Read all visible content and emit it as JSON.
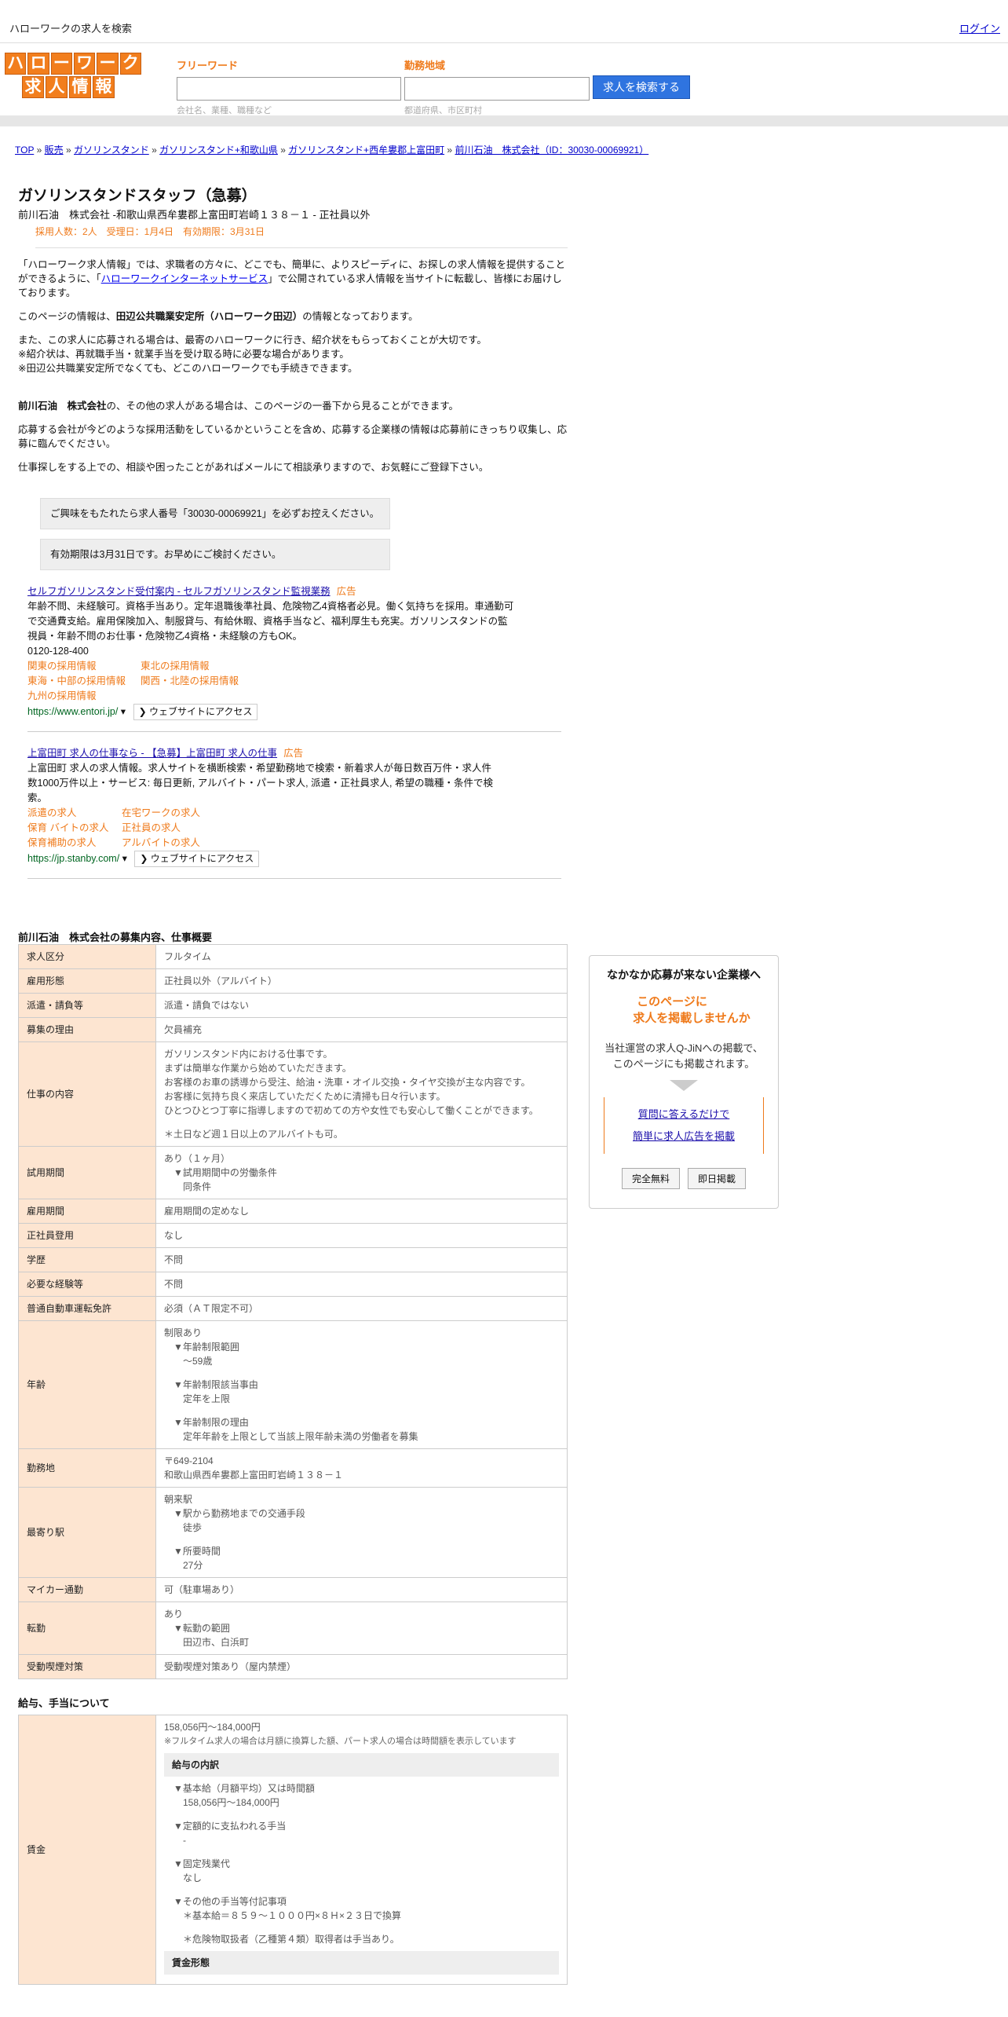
{
  "topbar": {
    "site_name": "ハローワークの求人を検索",
    "login": "ログイン"
  },
  "logo": {
    "row1": [
      "ハ",
      "ロ",
      "ー",
      "ワ",
      "ー",
      "ク"
    ],
    "row2": [
      "求",
      "人",
      "情",
      "報"
    ]
  },
  "search": {
    "freeword_label": "フリーワード",
    "freeword_hint": "会社名、業種、職種など",
    "area_label": "勤務地域",
    "area_hint": "都道府県、市区町村",
    "button": "求人を検索する"
  },
  "breadcrumb": {
    "items": [
      "TOP",
      "販売",
      "ガソリンスタンド",
      "ガソリンスタンド+和歌山県",
      "ガソリンスタンド+西牟婁郡上富田町",
      "前川石油　株式会社（ID：30030-00069921）"
    ],
    "sep": "»"
  },
  "job": {
    "title": "ガソリンスタンドスタッフ（急募）",
    "subtitle": "前川石油　株式会社 -和歌山県西牟婁郡上富田町岩崎１３８－１ - 正社員以外",
    "meta": "採用人数：2人　受理日：1月4日　有効期限：3月31日"
  },
  "intro": {
    "p1_a": "「ハローワーク求人情報」では、求職者の方々に、どこでも、簡単に、よりスピーディに、お探しの求人情報を提供することができるように、「",
    "p1_link": "ハローワークインターネットサービス",
    "p1_b": "」で公開されている求人情報を当サイトに転載し、皆様にお届けしております。",
    "p2_a": "このページの情報は、",
    "p2_bold": "田辺公共職業安定所（ハローワーク田辺）",
    "p2_b": "の情報となっております。",
    "p3": "また、この求人に応募される場合は、最寄のハローワークに行き、紹介状をもらっておくことが大切です。",
    "p3_2": "※紹介状は、再就職手当・就業手当を受け取る時に必要な場合があります。",
    "p3_3": "※田辺公共職業安定所でなくても、どこのハローワークでも手続きできます。",
    "p4_bold": "前川石油　株式会社",
    "p4": "の、その他の求人がある場合は、このページの一番下から見ることができます。",
    "p5": "応募する会社が今どのような採用活動をしているかということを含め、応募する企業様の情報は応募前にきっちり収集し、応募に臨んでください。",
    "p6": "仕事探しをする上での、相談や困ったことがあればメールにて相談承りますので、お気軽にご登録下さい。",
    "box1": "ご興味をもたれたら求人番号「30030-00069921」を必ずお控えください。",
    "box2": "有効期限は3月31日です。お早めにご検討ください。"
  },
  "ads": [
    {
      "title": "セルフガソリンスタンド受付案内 - セルフガソリンスタンド監視業務",
      "tag": "広告",
      "body": "年齢不問、未経験可。資格手当あり。定年退職後準社員、危険物乙4資格者必見。働く気持ちを採用。車通勤可で交通費支給。雇用保険加入、制服貸与、有給休暇、資格手当など、福利厚生も充実。ガソリンスタンドの監視員・年齢不問のお仕事・危険物乙4資格・未経験の方もOK。",
      "phone": "0120-128-400",
      "links": [
        "関東の採用情報",
        "東北の採用情報",
        "東海・中部の採用情報",
        "関西・北陸の採用情報",
        "九州の採用情報"
      ],
      "url": "https://www.entori.jp/",
      "visit": "❯ ウェブサイトにアクセス"
    },
    {
      "title": "上富田町 求人の仕事なら - 【急募】上富田町 求人の仕事",
      "tag": "広告",
      "body": "上富田町 求人の求人情報。求人サイトを横断検索・希望勤務地で検索・新着求人が毎日数百万件・求人件数1000万件以上・サービス: 毎日更新, アルバイト・パート求人, 派遣・正社員求人, 希望の職種・条件で検索。",
      "phone": "",
      "links": [
        "派遣の求人",
        "在宅ワークの求人",
        "保育 バイトの求人",
        "正社員の求人",
        "保育補助の求人",
        "アルバイトの求人"
      ],
      "url": "https://jp.stanby.com/",
      "visit": "❯ ウェブサイトにアクセス"
    }
  ],
  "details": {
    "title": "前川石油　株式会社の募集内容、仕事概要",
    "rows": [
      {
        "k": "求人区分",
        "v": [
          "フルタイム"
        ]
      },
      {
        "k": "雇用形態",
        "v": [
          "正社員以外（アルバイト）"
        ]
      },
      {
        "k": "派遣・請負等",
        "v": [
          "派遣・請負ではない"
        ]
      },
      {
        "k": "募集の理由",
        "v": [
          "欠員補充"
        ]
      },
      {
        "k": "仕事の内容",
        "v": [
          "ガソリンスタンド内における仕事です。",
          "まずは簡単な作業から始めていただきます。",
          "お客様のお車の誘導から受注、給油・洗車・オイル交換・タイヤ交換が主な内容です。",
          "お客様に気持ち良く来店していただくために清掃も日々行います。",
          "ひとつひとつ丁寧に指導しますので初めての方や女性でも安心して働くことができます。",
          "",
          "＊土日など週１日以上のアルバイトも可。"
        ]
      },
      {
        "k": "試用期間",
        "v": [
          "あり（１ヶ月）",
          "▼試用期間中の労働条件",
          "同条件"
        ]
      },
      {
        "k": "雇用期間",
        "v": [
          "雇用期間の定めなし"
        ]
      },
      {
        "k": "正社員登用",
        "v": [
          "なし"
        ]
      },
      {
        "k": "学歴",
        "v": [
          "不問"
        ]
      },
      {
        "k": "必要な経験等",
        "v": [
          "不問"
        ]
      },
      {
        "k": "普通自動車運転免許",
        "v": [
          "必須（ＡＴ限定不可）"
        ]
      },
      {
        "k": "年齢",
        "v": [
          "制限あり",
          "▼年齢制限範囲",
          "〜59歳",
          "",
          "▼年齢制限該当事由",
          "定年を上限",
          "",
          "▼年齢制限の理由",
          "定年年齢を上限として当該上限年齢未満の労働者を募集"
        ]
      },
      {
        "k": "勤務地",
        "v": [
          "〒649-2104",
          "和歌山県西牟婁郡上富田町岩崎１３８－１"
        ]
      },
      {
        "k": "最寄り駅",
        "v": [
          "朝来駅",
          "▼駅から勤務地までの交通手段",
          "徒歩",
          "",
          "▼所要時間",
          "27分"
        ]
      },
      {
        "k": "マイカー通勤",
        "v": [
          "可（駐車場あり）"
        ]
      },
      {
        "k": "転勤",
        "v": [
          "あり",
          "▼転勤の範囲",
          "田辺市、白浜町"
        ]
      },
      {
        "k": "受動喫煙対策",
        "v": [
          "受動喫煙対策あり（屋内禁煙）"
        ]
      }
    ]
  },
  "salary": {
    "title": "給与、手当について",
    "key": "賃金",
    "range": "158,056円〜184,000円",
    "note": "※フルタイム求人の場合は月額に換算した額、パート求人の場合は時間額を表示しています",
    "breakdown_title": "給与の内訳",
    "lines": [
      "▼基本給（月額平均）又は時間額",
      "158,056円〜184,000円",
      "",
      "▼定額的に支払われる手当",
      "-",
      "",
      "▼固定残業代",
      "なし",
      "",
      "▼その他の手当等付記事項",
      "＊基本給＝８５９～１０００円×８Ｈ×２３日で換算",
      "",
      "＊危険物取扱者（乙種第４類）取得者は手当あり。"
    ],
    "form_title": "賃金形態"
  },
  "side": {
    "question": "なかなか応募が来ない企業様へ",
    "headline1": "このページに",
    "headline2": "求人を掲載しませんか",
    "desc1": "当社運営の求人Q-JiNへの掲載で、",
    "desc2": "このページにも掲載されます。",
    "cta1": "質問に答えるだけで",
    "cta2": "簡単に求人広告を掲載",
    "btn1": "完全無料",
    "btn2": "即日掲載"
  }
}
